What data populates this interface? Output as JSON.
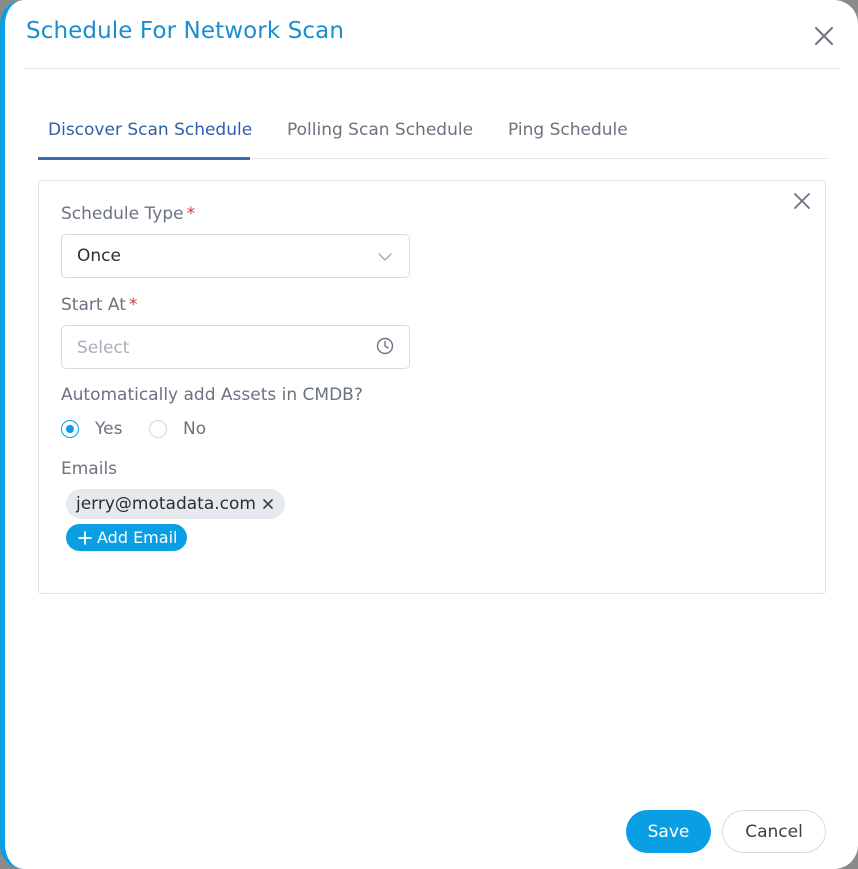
{
  "dialog": {
    "title": "Schedule For Network Scan"
  },
  "tabs": [
    {
      "label": "Discover Scan Schedule",
      "active": true
    },
    {
      "label": "Polling Scan Schedule",
      "active": false
    },
    {
      "label": "Ping Schedule",
      "active": false
    }
  ],
  "form": {
    "schedule_type": {
      "label": "Schedule Type",
      "required_mark": "*",
      "value": "Once",
      "icon": "chevron-down-icon"
    },
    "start_at": {
      "label": "Start At",
      "required_mark": "*",
      "placeholder": "Select",
      "icon": "clock-icon"
    },
    "auto_add_assets": {
      "label": "Automatically add Assets in CMDB?",
      "options": [
        {
          "label": "Yes",
          "checked": true
        },
        {
          "label": "No",
          "checked": false
        }
      ]
    },
    "emails": {
      "label": "Emails",
      "items": [
        "jerry@motadata.com"
      ],
      "add_label": "Add Email"
    }
  },
  "footer": {
    "save_label": "Save",
    "cancel_label": "Cancel"
  },
  "colors": {
    "accent": "#0a9ee3",
    "title": "#1a8ecf",
    "active_tab": "#2f5fa8",
    "required": "#d9363e"
  }
}
